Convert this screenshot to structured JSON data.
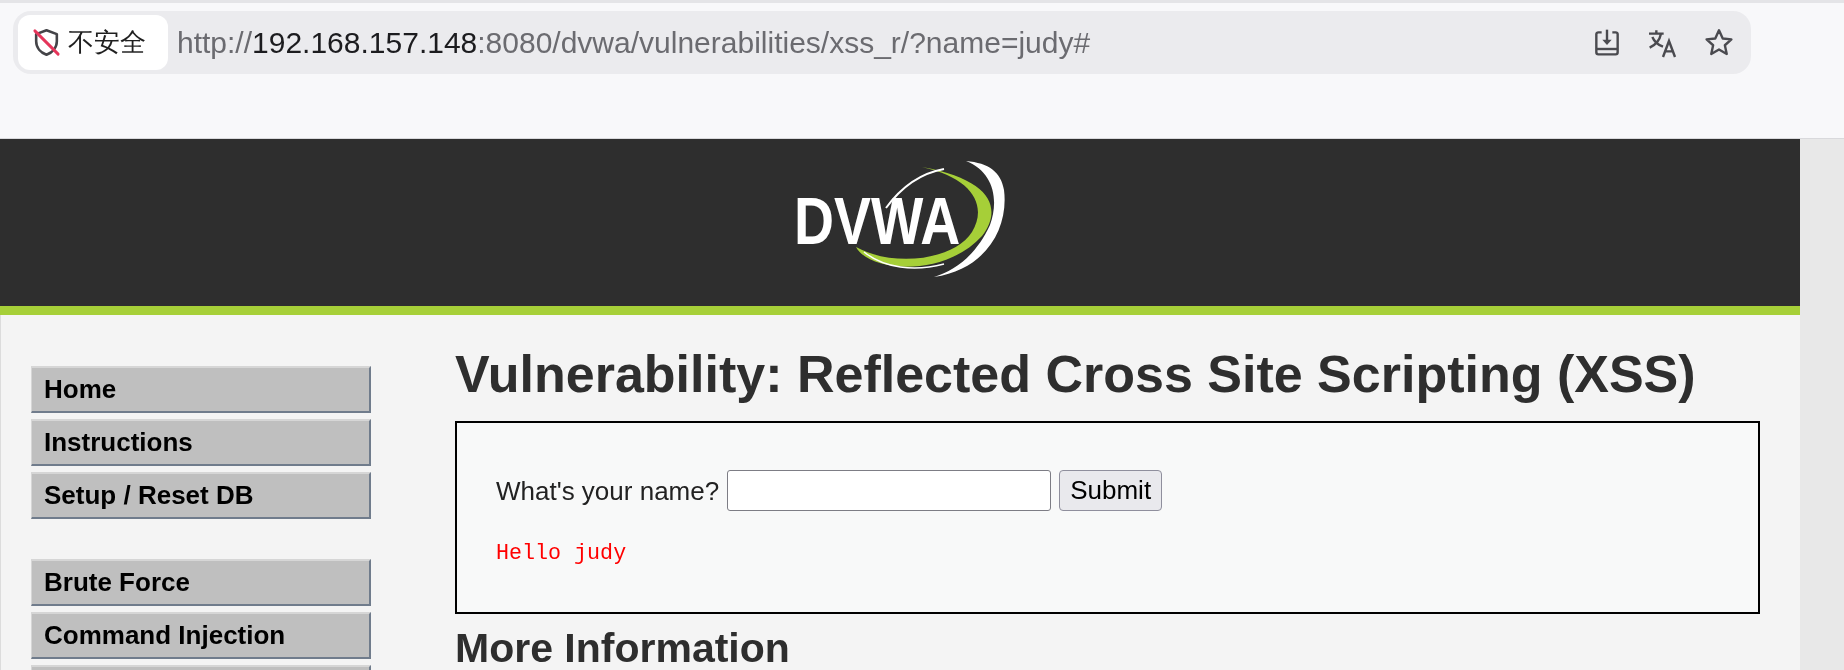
{
  "browser": {
    "security_label": "不安全",
    "url": {
      "scheme": "http://",
      "host": "192.168.157.148",
      "rest": ":8080/dvwa/vulnerabilities/xss_r/?name=judy#"
    },
    "bookmarked": false
  },
  "header": {
    "logo_text": "DVWA"
  },
  "sidebar": {
    "groups": [
      {
        "items": [
          {
            "label": "Home",
            "selected": false
          },
          {
            "label": "Instructions",
            "selected": false
          },
          {
            "label": "Setup / Reset DB",
            "selected": false
          }
        ]
      },
      {
        "items": [
          {
            "label": "Brute Force",
            "selected": false
          },
          {
            "label": "Command Injection",
            "selected": false
          },
          {
            "selected": false
          }
        ]
      }
    ]
  },
  "main": {
    "title": "Vulnerability: Reflected Cross Site Scripting (XSS)",
    "form": {
      "label": "What's your name?",
      "button": "Submit",
      "output": "Hello judy"
    },
    "next_heading": "More Information"
  }
}
